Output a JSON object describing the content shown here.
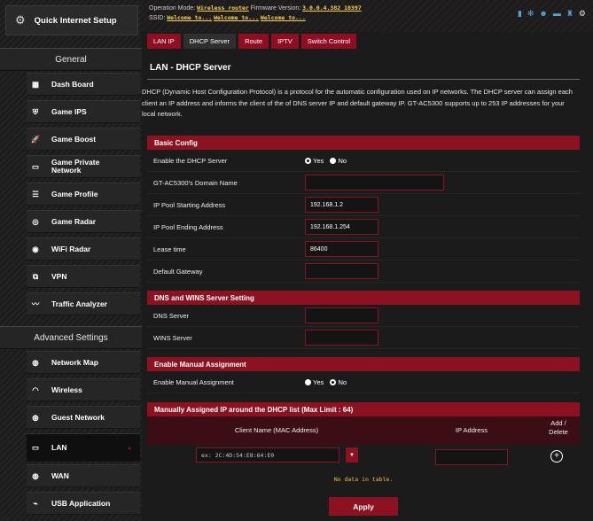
{
  "sidebar": {
    "quick_setup": "Quick Internet Setup",
    "general_title": "General",
    "general_items": [
      {
        "label": "Dash Board",
        "icon": "dashboard-icon"
      },
      {
        "label": "Game IPS",
        "icon": "shield-icon"
      },
      {
        "label": "Game Boost",
        "icon": "rocket-icon"
      },
      {
        "label": "Game Private Network",
        "icon": "monitor-icon"
      },
      {
        "label": "Game Profile",
        "icon": "profile-icon"
      },
      {
        "label": "Game Radar",
        "icon": "radar-icon"
      },
      {
        "label": "WiFi Radar",
        "icon": "wifi-radar-icon"
      },
      {
        "label": "VPN",
        "icon": "vpn-icon"
      },
      {
        "label": "Traffic Analyzer",
        "icon": "analyzer-icon"
      }
    ],
    "advanced_title": "Advanced Settings",
    "advanced_items": [
      {
        "label": "Network Map",
        "icon": "globe-icon"
      },
      {
        "label": "Wireless",
        "icon": "wireless-icon"
      },
      {
        "label": "Guest Network",
        "icon": "guest-icon"
      },
      {
        "label": "LAN",
        "icon": "lan-icon",
        "active": true
      },
      {
        "label": "WAN",
        "icon": "wan-icon"
      },
      {
        "label": "USB Application",
        "icon": "usb-icon"
      }
    ]
  },
  "topbar": {
    "op_mode_label": "Operation Mode:",
    "op_mode_value": "Wireless router",
    "fw_label": "Firmware Version:",
    "fw_value": "3.0.0.4.382_10397",
    "ssid_label": "SSID:",
    "ssid_values": [
      "Welcome to...",
      "Welcome to...",
      "Welcome to..."
    ]
  },
  "tabs": [
    "LAN IP",
    "DHCP Server",
    "Route",
    "IPTV",
    "Switch Control"
  ],
  "active_tab": "DHCP Server",
  "page": {
    "title": "LAN - DHCP Server",
    "description": "DHCP (Dynamic Host Configuration Protocol) is a protocol for the automatic configuration used on IP networks. The DHCP server can assign each client an IP address and informs the client of the of DNS server IP and default gateway IP. GT-AC5300 supports up to 253 IP addresses for your local network."
  },
  "basic": {
    "title": "Basic Config",
    "enable_label": "Enable the DHCP Server",
    "yes": "Yes",
    "no": "No",
    "enable_value": "Yes",
    "domain_label": "GT-AC5300's Domain Name",
    "domain_value": "",
    "start_label": "IP Pool Starting Address",
    "start_value": "192.168.1.2",
    "end_label": "IP Pool Ending Address",
    "end_value": "192.168.1.254",
    "lease_label": "Lease time",
    "lease_value": "86400",
    "gateway_label": "Default Gateway",
    "gateway_value": ""
  },
  "dns": {
    "title": "DNS and WINS Server Setting",
    "dns_label": "DNS Server",
    "dns_value": "",
    "wins_label": "WINS Server",
    "wins_value": ""
  },
  "manual": {
    "title": "Enable Manual Assignment",
    "label": "Enable Manual Assignment",
    "yes": "Yes",
    "no": "No",
    "value": "No"
  },
  "table": {
    "title": "Manually Assigned IP around the DHCP list (Max Limit : 64)",
    "col_client": "Client Name (MAC Address)",
    "col_ip": "IP Address",
    "col_action_1": "Add /",
    "col_action_2": "Delete",
    "mac_placeholder": "ex: 2C:4D:54:E8:64:E0",
    "empty_text": "No data in table."
  },
  "apply_label": "Apply",
  "colors": {
    "accent": "#8c1221",
    "background": "#1b1b1b"
  }
}
